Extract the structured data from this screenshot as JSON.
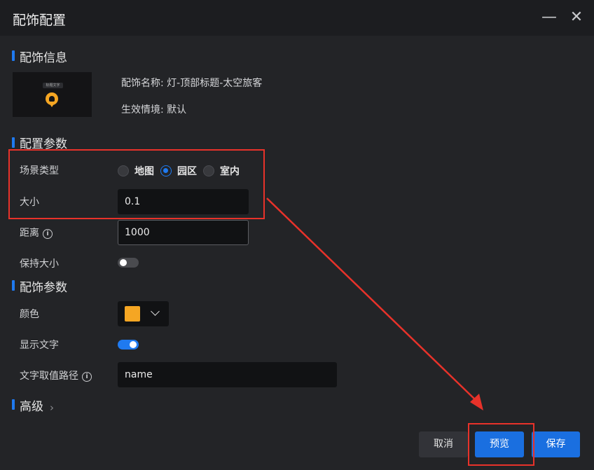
{
  "dialog": {
    "title": "配饰配置",
    "minimize_icon": "minimize-icon",
    "close_icon": "close-icon"
  },
  "info_section": {
    "title": "配饰信息",
    "thumbnail_chip": "标题文字",
    "name_text": "配饰名称: 灯-顶部标题-太空旅客",
    "scene_text": "生效情境: 默认"
  },
  "config_section": {
    "title": "配置参数",
    "scene_type_label": "场景类型",
    "scene_options": [
      "地图",
      "园区",
      "室内"
    ],
    "scene_selected": "园区",
    "size_label": "大小",
    "size_value": "0.1",
    "distance_label": "距离",
    "distance_value": "1000",
    "keep_size_label": "保持大小",
    "keep_size_on": false
  },
  "accessory_section": {
    "title": "配饰参数",
    "color_label": "颜色",
    "color_value": "#f5a623",
    "show_text_label": "显示文字",
    "show_text_on": true,
    "text_path_label": "文字取值路径",
    "text_path_value": "name"
  },
  "advanced": {
    "title": "高级"
  },
  "footer": {
    "cancel_label": "取消",
    "preview_label": "预览",
    "save_label": "保存"
  },
  "colors": {
    "accent": "#1f7af0",
    "annotation": "#e8322a"
  }
}
